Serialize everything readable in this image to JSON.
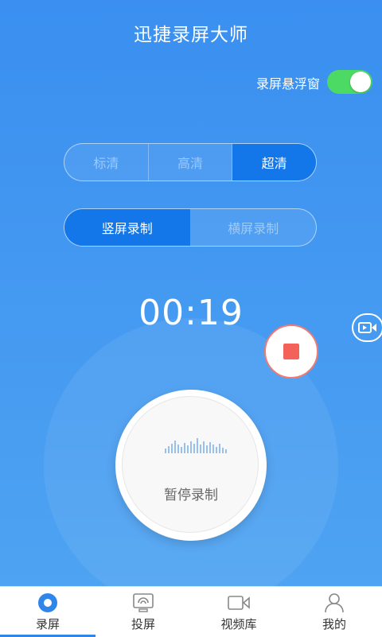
{
  "app_title": "迅捷录屏大师",
  "floating_window": {
    "label": "录屏悬浮窗",
    "enabled": true
  },
  "quality": {
    "options": [
      "标清",
      "高清",
      "超清"
    ],
    "selected": "超清"
  },
  "orientation": {
    "options": [
      "竖屏录制",
      "横屏录制"
    ],
    "selected": "竖屏录制"
  },
  "timer": "00:19",
  "main_button_label": "暂停录制",
  "tabs": [
    {
      "label": "录屏",
      "icon": "record-icon",
      "active": true
    },
    {
      "label": "投屏",
      "icon": "cast-icon"
    },
    {
      "label": "视频库",
      "icon": "video-library-icon"
    },
    {
      "label": "我的",
      "icon": "profile-icon"
    }
  ],
  "colors": {
    "primary": "#3a8ff0",
    "toggle_on": "#4cd964",
    "stop_red": "#f4615a",
    "segment_active": "#1377ea"
  }
}
